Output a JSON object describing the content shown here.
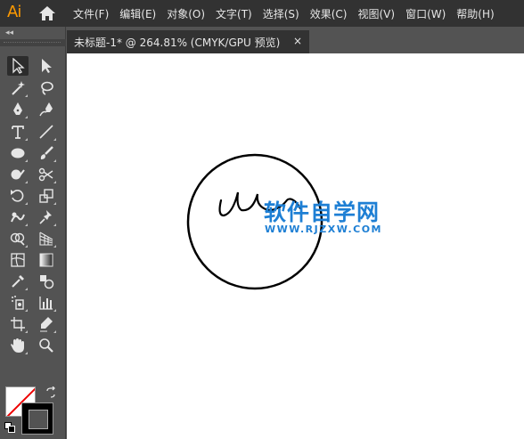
{
  "app": {
    "logo": "Ai",
    "home_icon": "home-icon"
  },
  "menu": [
    "文件(F)",
    "编辑(E)",
    "对象(O)",
    "文字(T)",
    "选择(S)",
    "效果(C)",
    "视图(V)",
    "窗口(W)",
    "帮助(H)"
  ],
  "panel": {
    "collapse_glyph": "◂◂"
  },
  "document": {
    "tab_label": "未标题-1* @ 264.81% (CMYK/GPU 预览)",
    "close_glyph": "×"
  },
  "canvas": {
    "watermark_title": "软件自学网",
    "watermark_url": "WWW.RJZXW.COM"
  },
  "colors": {
    "menubar": "#323232",
    "panel": "#535353",
    "canvas": "#ffffff",
    "accent_logo": "#ff9a00",
    "watermark": "#1e7fd4"
  }
}
